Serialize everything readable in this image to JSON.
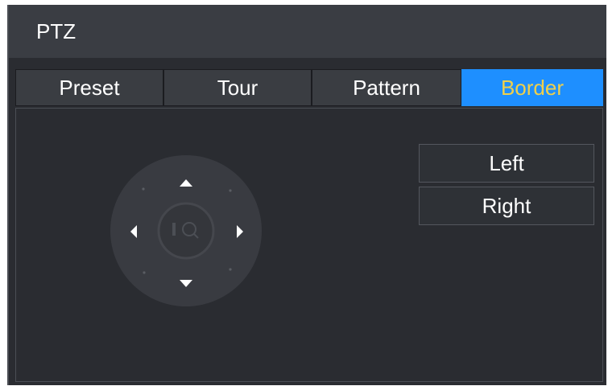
{
  "window": {
    "title": "PTZ"
  },
  "tabs": [
    {
      "label": "Preset",
      "active": false
    },
    {
      "label": "Tour",
      "active": false
    },
    {
      "label": "Pattern",
      "active": false
    },
    {
      "label": "Border",
      "active": true
    }
  ],
  "border_panel": {
    "left_label": "Left",
    "right_label": "Right"
  },
  "ptz_control": {
    "icons": [
      "up-arrow-icon",
      "down-arrow-icon",
      "left-arrow-icon",
      "right-arrow-icon",
      "zoom-center-icon"
    ]
  },
  "colors": {
    "active_tab_bg": "#1e8fff",
    "active_tab_text": "#f0d04a",
    "panel_bg": "#2a2c31",
    "titlebar_bg": "#3a3d43"
  }
}
